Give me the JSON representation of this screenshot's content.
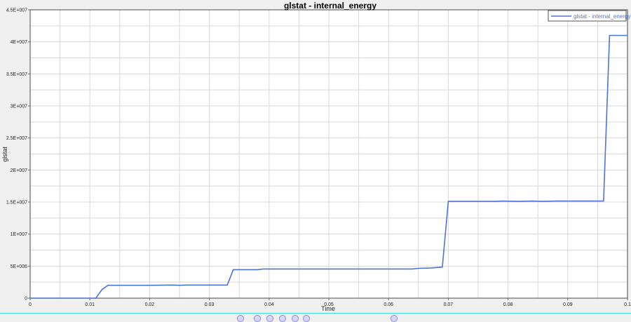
{
  "chart_data": {
    "type": "line",
    "title": "glstat - internal_energy",
    "xlabel": "Time",
    "ylabel": "glstat",
    "xlim": [
      0,
      0.1
    ],
    "ylim": [
      0,
      45000000
    ],
    "grid": true,
    "legend_placement": "top-right",
    "x_ticks": [
      "0",
      "0.01",
      "0.02",
      "0.03",
      "0.04",
      "0.05",
      "0.06",
      "0.07",
      "0.08",
      "0.09",
      "0.1"
    ],
    "y_ticks": [
      "0",
      "5E+006",
      "1E+007",
      "1.5E+007",
      "2E+007",
      "2.5E+007",
      "3E+007",
      "3.5E+007",
      "4E+007",
      "4.5E+007"
    ],
    "series": [
      {
        "name": "glstat - internal_energy",
        "color": "#4f74d9",
        "x": [
          0,
          0.011,
          0.012,
          0.013,
          0.02,
          0.024,
          0.025,
          0.026,
          0.033,
          0.034,
          0.038,
          0.039,
          0.05,
          0.064,
          0.065,
          0.067,
          0.069,
          0.07,
          0.078,
          0.079,
          0.082,
          0.084,
          0.086,
          0.088,
          0.09,
          0.096,
          0.097,
          0.1
        ],
        "y": [
          0,
          0,
          1300000,
          2000000,
          2000000,
          2050000,
          2000000,
          2050000,
          2050000,
          4450000,
          4450000,
          4550000,
          4550000,
          4550000,
          4650000,
          4700000,
          4850000,
          15100000,
          15100000,
          15150000,
          15100000,
          15150000,
          15100000,
          15150000,
          15150000,
          15150000,
          41000000,
          41000000
        ]
      }
    ]
  }
}
